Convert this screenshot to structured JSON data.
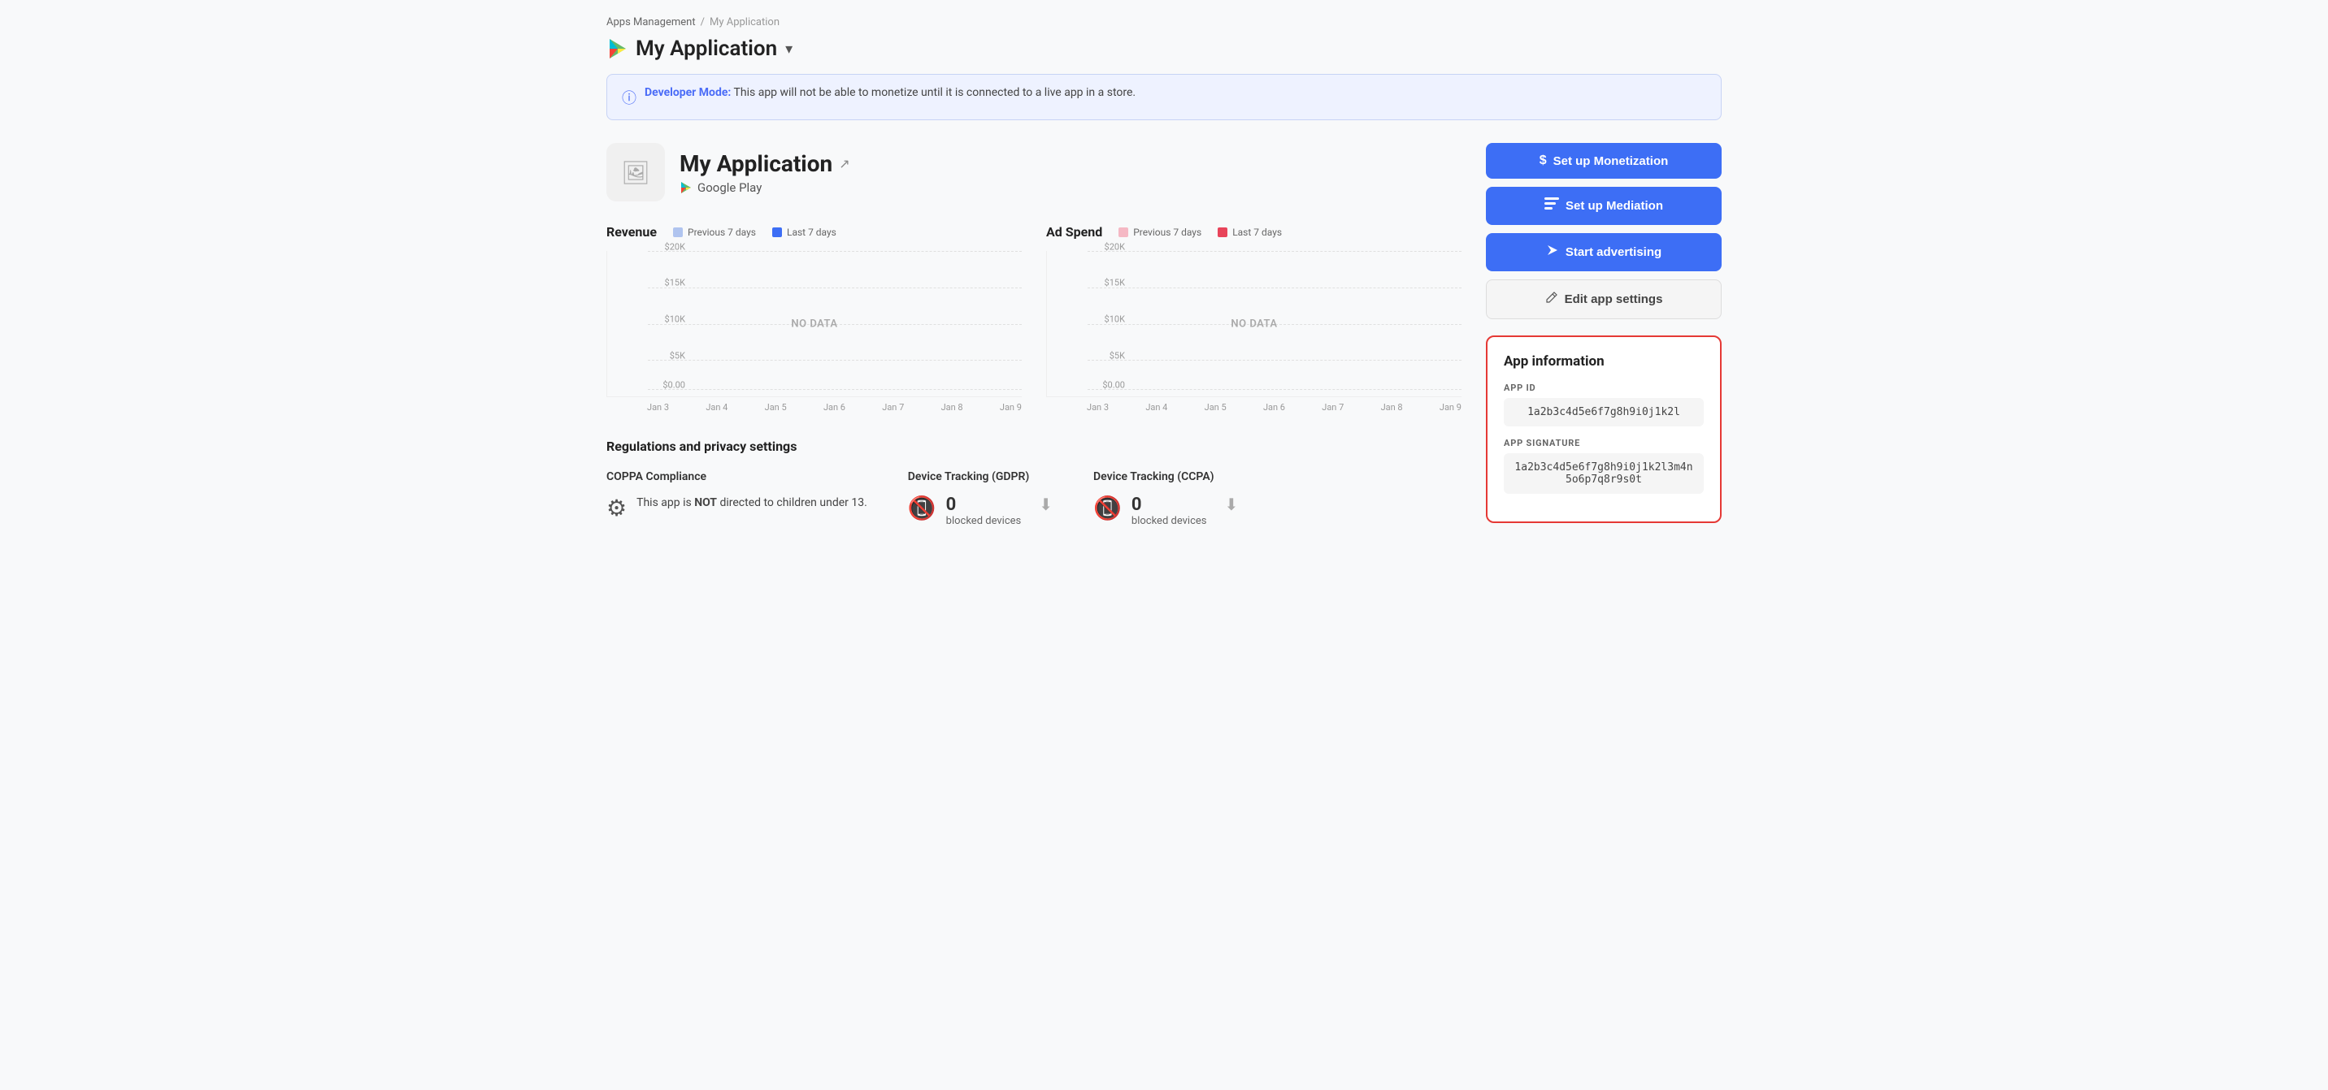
{
  "breadcrumb": {
    "parent": "Apps Management",
    "separator": "/",
    "current": "My Application"
  },
  "appHeader": {
    "title": "My Application",
    "dropdownLabel": "▾"
  },
  "devModeBanner": {
    "iconLabel": "ℹ",
    "strongText": "Developer Mode:",
    "message": " This app will not be able to monetize until it is connected to a live app in a store."
  },
  "appCard": {
    "name": "My Application",
    "platform": "Google Play",
    "externalLinkIcon": "↗"
  },
  "charts": {
    "revenue": {
      "title": "Revenue",
      "legend": [
        {
          "label": "Previous 7 days",
          "color": "#b0c4ef"
        },
        {
          "label": "Last 7 days",
          "color": "#3d6ef5"
        }
      ],
      "yLabels": [
        "$20K",
        "$15K",
        "$10K",
        "$5K",
        "$0.00"
      ],
      "xLabels": [
        "Jan 3",
        "Jan 4",
        "Jan 5",
        "Jan 6",
        "Jan 7",
        "Jan 8",
        "Jan 9"
      ],
      "noDataText": "NO DATA"
    },
    "adSpend": {
      "title": "Ad Spend",
      "legend": [
        {
          "label": "Previous 7 days",
          "color": "#f5b8c4"
        },
        {
          "label": "Last 7 days",
          "color": "#e8445a"
        }
      ],
      "yLabels": [
        "$20K",
        "$15K",
        "$10K",
        "$5K",
        "$0.00"
      ],
      "xLabels": [
        "Jan 3",
        "Jan 4",
        "Jan 5",
        "Jan 6",
        "Jan 7",
        "Jan 8",
        "Jan 9"
      ],
      "noDataText": "NO DATA"
    }
  },
  "buttons": {
    "monetization": {
      "label": "Set up Monetization",
      "icon": "$"
    },
    "mediation": {
      "label": "Set up Mediation",
      "icon": "≡"
    },
    "advertising": {
      "label": "Start advertising",
      "icon": "▷"
    },
    "editSettings": {
      "label": "Edit app settings",
      "icon": "✎"
    }
  },
  "appInformation": {
    "title": "App information",
    "appIdLabel": "APP ID",
    "appIdValue": "1a2b3c4d5e6f7g8h9i0j1k2l",
    "appSignatureLabel": "APP SIGNATURE",
    "appSignatureValue": "1a2b3c4d5e6f7g8h9i0j1k2l3m4n5o6p7q8r9s0t"
  },
  "regulations": {
    "title": "Regulations and privacy settings",
    "coppa": {
      "label": "COPPA Compliance",
      "description": "This app is NOT directed to children under 13."
    },
    "gdpr": {
      "label": "Device Tracking (GDPR)",
      "count": "0",
      "description": "blocked devices"
    },
    "ccpa": {
      "label": "Device Tracking (CCPA)",
      "count": "0",
      "description": "blocked devices"
    }
  }
}
